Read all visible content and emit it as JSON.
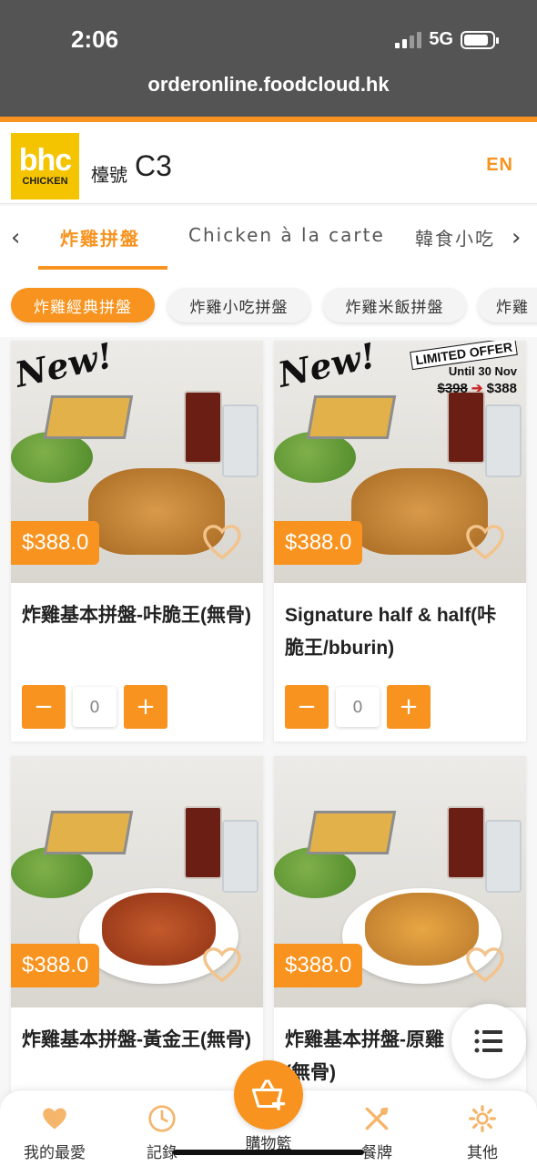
{
  "status_bar": {
    "time": "2:06",
    "network": "5G"
  },
  "browser": {
    "url": "orderonline.foodcloud.hk"
  },
  "header": {
    "logo_main": "bhc",
    "logo_sub": "CHICKEN",
    "table_label": "檯號",
    "table_number": "C3",
    "language": "EN"
  },
  "category_tabs": [
    {
      "label": "炸雞拼盤",
      "active": true
    },
    {
      "label": "Chicken à la carte",
      "active": false
    },
    {
      "label": "韓食小吃",
      "active": false
    }
  ],
  "sub_categories": [
    {
      "label": "炸雞經典拼盤",
      "active": true
    },
    {
      "label": "炸雞小吃拼盤",
      "active": false
    },
    {
      "label": "炸雞米飯拼盤",
      "active": false
    },
    {
      "label": "炸雞",
      "active": false
    }
  ],
  "products": [
    {
      "name": "炸雞基本拼盤-咔脆王(無骨)",
      "price": "$388.0",
      "quantity": "0",
      "badge": "New!"
    },
    {
      "name": "Signature half & half(咔脆王/bburin)",
      "price": "$388.0",
      "quantity": "0",
      "badge": "New!",
      "offer": {
        "title": "LIMITED OFFER",
        "until": "Until 30 Nov",
        "old_price": "$398",
        "new_price": "$388"
      }
    },
    {
      "name": "炸雞基本拼盤-黃金王(無骨)",
      "price": "$388.0"
    },
    {
      "name": "炸雞基本拼盤-原雞(無骨)",
      "price": "$388.0"
    }
  ],
  "bottom_nav": [
    {
      "label": "我的最愛",
      "icon": "heart-icon"
    },
    {
      "label": "記錄",
      "icon": "clock-icon"
    },
    {
      "label": "購物籃",
      "icon": "basket-icon"
    },
    {
      "label": "餐牌",
      "icon": "utensils-icon"
    },
    {
      "label": "其他",
      "icon": "gear-icon"
    }
  ],
  "colors": {
    "accent": "#f7931e",
    "logo_yellow": "#f5c400",
    "browser_bar": "#545454"
  }
}
